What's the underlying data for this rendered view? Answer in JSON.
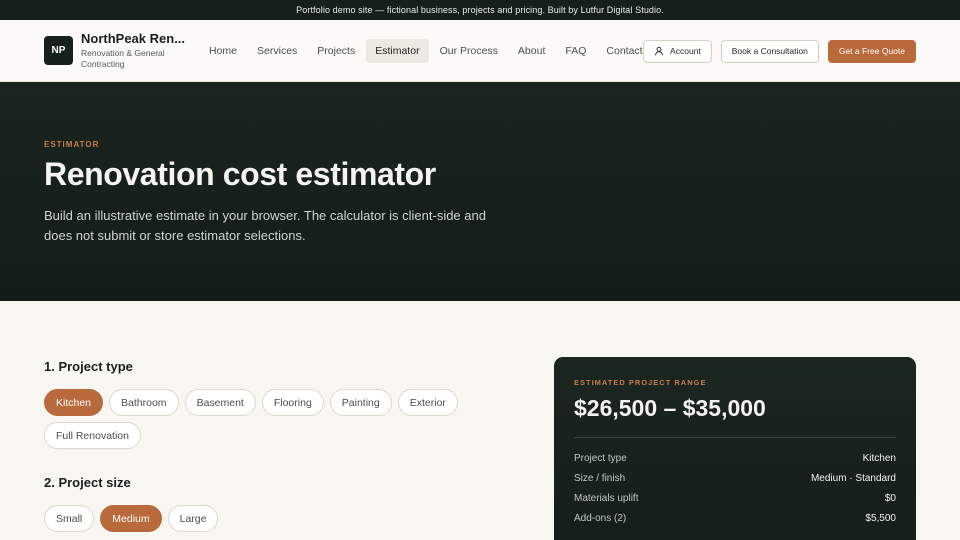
{
  "banner": "Portfolio demo site — fictional business, projects and pricing. Built by Lutfur Digital Studio.",
  "brand": {
    "logo": "NP",
    "name": "NorthPeak Ren...",
    "subtitle": "Renovation & General Contracting"
  },
  "nav": [
    "Home",
    "Services",
    "Projects",
    "Estimator",
    "Our Process",
    "About",
    "FAQ",
    "Contact"
  ],
  "actions": {
    "account": "Account",
    "consultation": "Book a Consultation",
    "quote": "Get a Free Quote"
  },
  "hero": {
    "eyebrow": "ESTIMATOR",
    "title": "Renovation cost estimator",
    "description": "Build an illustrative estimate in your browser. The calculator is client-side and does not submit or store estimator selections."
  },
  "project_type": {
    "title": "1. Project type",
    "options": [
      "Kitchen",
      "Bathroom",
      "Basement",
      "Flooring",
      "Painting",
      "Exterior",
      "Full Renovation"
    ],
    "selected": "Kitchen"
  },
  "project_size": {
    "title": "2. Project size",
    "options": [
      "Small",
      "Medium",
      "Large"
    ],
    "selected": "Medium"
  },
  "summary": {
    "eyebrow": "ESTIMATED PROJECT RANGE",
    "range": "$26,500 – $35,000",
    "rows": [
      {
        "label": "Project type",
        "value": "Kitchen"
      },
      {
        "label": "Size / finish",
        "value": "Medium · Standard"
      },
      {
        "label": "Materials uplift",
        "value": "$0"
      },
      {
        "label": "Add-ons (2)",
        "value": "$5,500"
      }
    ]
  },
  "colors": {
    "accent": "#b96a3c",
    "dark": "#16211b",
    "cream": "#f8f6f0"
  },
  "icons": {
    "account": "user-icon"
  }
}
